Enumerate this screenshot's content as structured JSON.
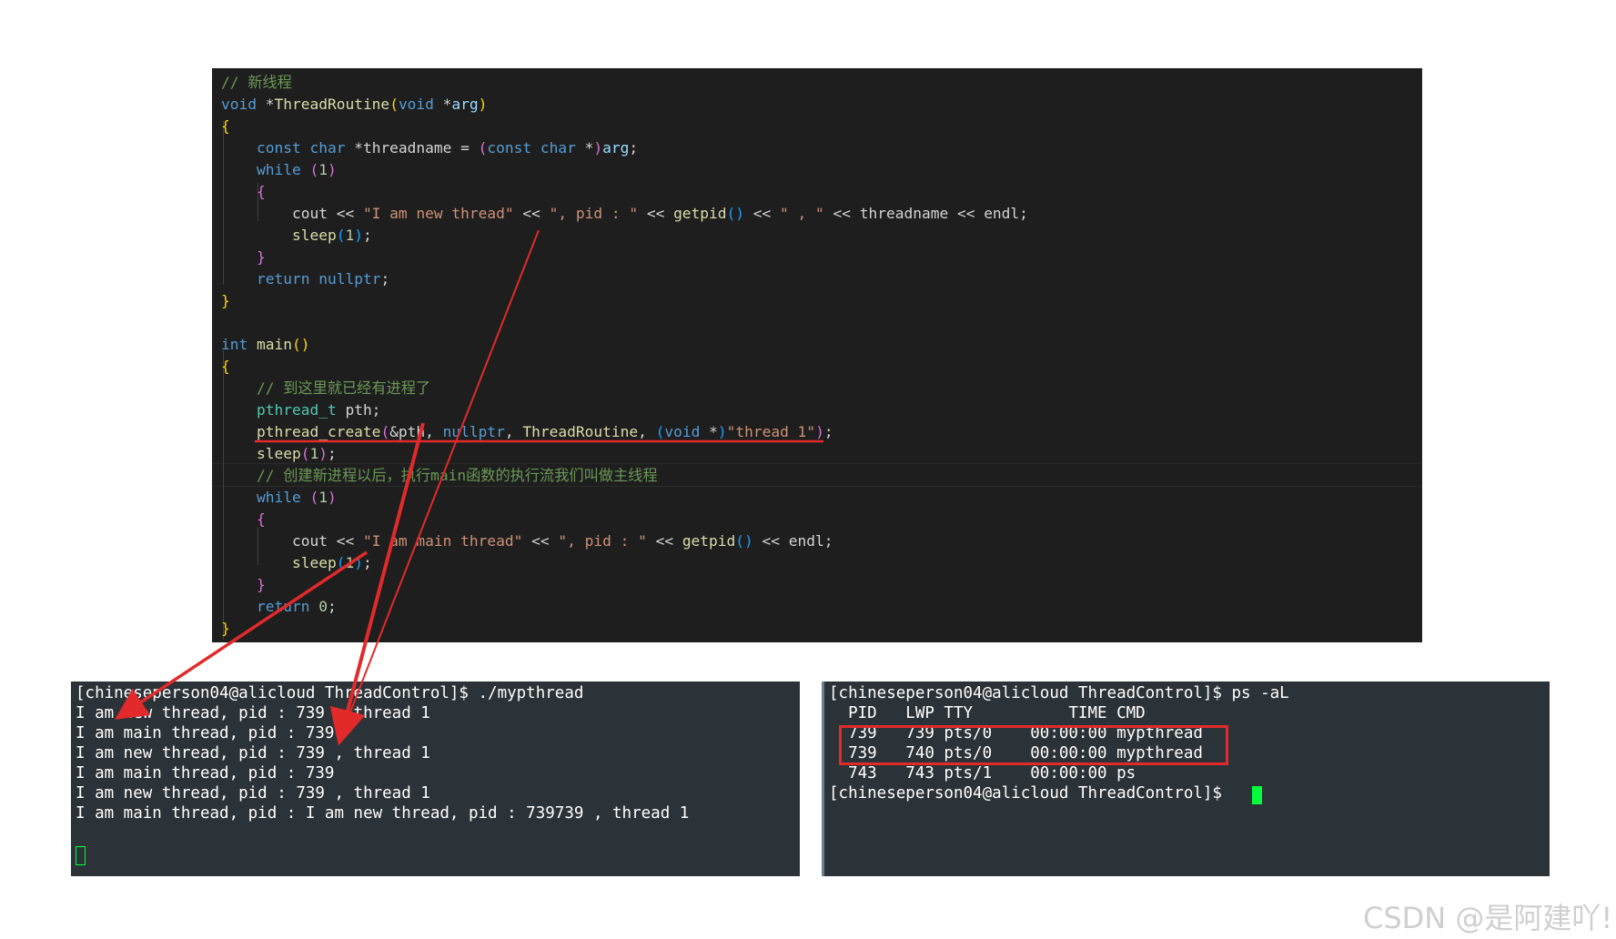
{
  "editor": {
    "lines": [
      {
        "parts": [
          {
            "c": "cm",
            "t": "// 新线程"
          }
        ]
      },
      {
        "parts": [
          {
            "c": "kw",
            "t": "void"
          },
          {
            "c": "",
            "t": " *"
          },
          {
            "c": "fn",
            "t": "ThreadRoutine"
          },
          {
            "c": "br1",
            "t": "("
          },
          {
            "c": "kw",
            "t": "void"
          },
          {
            "c": "",
            "t": " *"
          },
          {
            "c": "pm",
            "t": "arg"
          },
          {
            "c": "br1",
            "t": ")"
          }
        ]
      },
      {
        "parts": [
          {
            "c": "br1",
            "t": "{"
          }
        ]
      },
      {
        "parts": [
          {
            "c": "",
            "t": "    "
          },
          {
            "c": "kw",
            "t": "const"
          },
          {
            "c": "",
            "t": " "
          },
          {
            "c": "kw",
            "t": "char"
          },
          {
            "c": "",
            "t": " *threadname = "
          },
          {
            "c": "br2",
            "t": "("
          },
          {
            "c": "kw",
            "t": "const"
          },
          {
            "c": "",
            "t": " "
          },
          {
            "c": "kw",
            "t": "char"
          },
          {
            "c": "",
            "t": " *"
          },
          {
            "c": "br2",
            "t": ")"
          },
          {
            "c": "pm",
            "t": "arg"
          },
          {
            "c": "",
            "t": ";"
          }
        ]
      },
      {
        "parts": [
          {
            "c": "",
            "t": "    "
          },
          {
            "c": "kw",
            "t": "while"
          },
          {
            "c": "",
            "t": " "
          },
          {
            "c": "br2",
            "t": "("
          },
          {
            "c": "num",
            "t": "1"
          },
          {
            "c": "br2",
            "t": ")"
          }
        ]
      },
      {
        "parts": [
          {
            "c": "",
            "t": "    "
          },
          {
            "c": "br2",
            "t": "{"
          }
        ]
      },
      {
        "parts": [
          {
            "c": "",
            "t": "        cout << "
          },
          {
            "c": "str",
            "t": "\"I am new thread\""
          },
          {
            "c": "",
            "t": " << "
          },
          {
            "c": "str",
            "t": "\", pid : \""
          },
          {
            "c": "",
            "t": " << "
          },
          {
            "c": "fn",
            "t": "getpid"
          },
          {
            "c": "br3",
            "t": "()"
          },
          {
            "c": "",
            "t": " << "
          },
          {
            "c": "str",
            "t": "\" , \""
          },
          {
            "c": "",
            "t": " << threadname << endl;"
          }
        ]
      },
      {
        "parts": [
          {
            "c": "",
            "t": "        "
          },
          {
            "c": "fn",
            "t": "sleep"
          },
          {
            "c": "br3",
            "t": "("
          },
          {
            "c": "num",
            "t": "1"
          },
          {
            "c": "br3",
            "t": ")"
          },
          {
            "c": "",
            "t": ";"
          }
        ]
      },
      {
        "parts": [
          {
            "c": "",
            "t": "    "
          },
          {
            "c": "br2",
            "t": "}"
          }
        ]
      },
      {
        "parts": [
          {
            "c": "",
            "t": "    "
          },
          {
            "c": "kw",
            "t": "return"
          },
          {
            "c": "",
            "t": " "
          },
          {
            "c": "kw",
            "t": "nullptr"
          },
          {
            "c": "",
            "t": ";"
          }
        ]
      },
      {
        "parts": [
          {
            "c": "br1",
            "t": "}"
          }
        ]
      },
      {
        "parts": []
      },
      {
        "parts": [
          {
            "c": "kw",
            "t": "int"
          },
          {
            "c": "",
            "t": " "
          },
          {
            "c": "fn",
            "t": "main"
          },
          {
            "c": "br1",
            "t": "()"
          }
        ]
      },
      {
        "parts": [
          {
            "c": "br1",
            "t": "{"
          }
        ]
      },
      {
        "parts": [
          {
            "c": "",
            "t": "    "
          },
          {
            "c": "cm",
            "t": "// 到这里就已经有进程了"
          }
        ]
      },
      {
        "parts": [
          {
            "c": "",
            "t": "    "
          },
          {
            "c": "ty",
            "t": "pthread_t"
          },
          {
            "c": "",
            "t": " pth;"
          }
        ]
      },
      {
        "parts": [
          {
            "c": "",
            "t": "    "
          },
          {
            "c": "fn",
            "t": "pthread_create"
          },
          {
            "c": "br2",
            "t": "("
          },
          {
            "c": "",
            "t": "&pth, "
          },
          {
            "c": "kw",
            "t": "nullptr"
          },
          {
            "c": "",
            "t": ", "
          },
          {
            "c": "fn",
            "t": "ThreadRoutine"
          },
          {
            "c": "",
            "t": ", "
          },
          {
            "c": "br3",
            "t": "("
          },
          {
            "c": "kw",
            "t": "void"
          },
          {
            "c": "",
            "t": " *"
          },
          {
            "c": "br3",
            "t": ")"
          },
          {
            "c": "str",
            "t": "\"thread 1\""
          },
          {
            "c": "br2",
            "t": ")"
          },
          {
            "c": "",
            "t": ";"
          }
        ]
      },
      {
        "parts": [
          {
            "c": "",
            "t": "    "
          },
          {
            "c": "fn",
            "t": "sleep"
          },
          {
            "c": "br2",
            "t": "("
          },
          {
            "c": "num",
            "t": "1"
          },
          {
            "c": "br2",
            "t": ")"
          },
          {
            "c": "",
            "t": ";"
          }
        ]
      },
      {
        "parts": [
          {
            "c": "",
            "t": "    "
          },
          {
            "c": "cm",
            "t": "// 创建新进程以后，执行main函数的执行流我们叫做主线程"
          }
        ]
      },
      {
        "parts": [
          {
            "c": "",
            "t": "    "
          },
          {
            "c": "kw",
            "t": "while"
          },
          {
            "c": "",
            "t": " "
          },
          {
            "c": "br2",
            "t": "("
          },
          {
            "c": "num",
            "t": "1"
          },
          {
            "c": "br2",
            "t": ")"
          }
        ]
      },
      {
        "parts": [
          {
            "c": "",
            "t": "    "
          },
          {
            "c": "br2",
            "t": "{"
          }
        ]
      },
      {
        "parts": [
          {
            "c": "",
            "t": "        cout << "
          },
          {
            "c": "str",
            "t": "\"I am main thread\""
          },
          {
            "c": "",
            "t": " << "
          },
          {
            "c": "str",
            "t": "\", pid : \""
          },
          {
            "c": "",
            "t": " << "
          },
          {
            "c": "fn",
            "t": "getpid"
          },
          {
            "c": "br3",
            "t": "()"
          },
          {
            "c": "",
            "t": " << endl;"
          }
        ]
      },
      {
        "parts": [
          {
            "c": "",
            "t": "        "
          },
          {
            "c": "fn",
            "t": "sleep"
          },
          {
            "c": "br3",
            "t": "("
          },
          {
            "c": "num",
            "t": "1"
          },
          {
            "c": "br3",
            "t": ")"
          },
          {
            "c": "",
            "t": ";"
          }
        ]
      },
      {
        "parts": [
          {
            "c": "",
            "t": "    "
          },
          {
            "c": "br2",
            "t": "}"
          }
        ]
      },
      {
        "parts": [
          {
            "c": "",
            "t": "    "
          },
          {
            "c": "kw",
            "t": "return"
          },
          {
            "c": "",
            "t": " "
          },
          {
            "c": "num",
            "t": "0"
          },
          {
            "c": "",
            "t": ";"
          }
        ]
      },
      {
        "parts": [
          {
            "c": "br1",
            "t": "}"
          }
        ]
      }
    ]
  },
  "terminal_left": {
    "lines": [
      "[chineseperson04@alicloud ThreadControl]$ ./mypthread",
      "I am new thread, pid : 739 , thread 1",
      "I am main thread, pid : 739",
      "I am new thread, pid : 739 , thread 1",
      "I am main thread, pid : 739",
      "I am new thread, pid : 739 , thread 1",
      "I am main thread, pid : I am new thread, pid : 739739 , thread 1"
    ]
  },
  "terminal_right": {
    "lines": [
      "[chineseperson04@alicloud ThreadControl]$ ps -aL",
      "  PID   LWP TTY          TIME CMD",
      "  739   739 pts/0    00:00:00 mypthread",
      "  739   740 pts/0    00:00:00 mypthread",
      "  743   743 pts/1    00:00:00 ps",
      "[chineseperson04@alicloud ThreadControl]$ "
    ]
  },
  "watermark": "CSDN @是阿建吖!",
  "colors": {
    "annotation_red": "#e22a2a",
    "cursor_green": "#00ff3a"
  }
}
